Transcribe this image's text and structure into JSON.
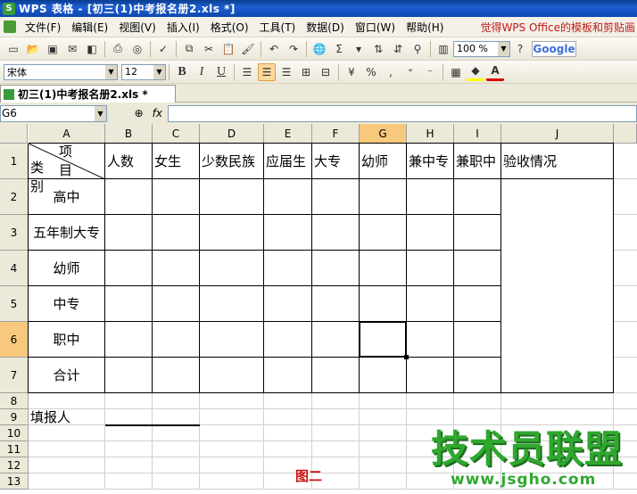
{
  "window": {
    "title": "WPS 表格 - [初三(1)中考报名册2.xls *]"
  },
  "menu": {
    "items": [
      "文件(F)",
      "编辑(E)",
      "视图(V)",
      "插入(I)",
      "格式(O)",
      "工具(T)",
      "数据(D)",
      "窗口(W)",
      "帮助(H)"
    ],
    "promo": "觉得WPS Office的模板和剪贴画"
  },
  "toolbar": {
    "zoom": "100 %",
    "search_brand": "Google"
  },
  "format_toolbar": {
    "font_name": "宋体",
    "font_size": "12",
    "bold": "B",
    "italic": "I",
    "underline": "U",
    "percent": "%"
  },
  "tabs": [
    {
      "label": "初三(1)中考报名册2.xls *"
    }
  ],
  "formula_bar": {
    "cell_ref": "G6",
    "fx": "fx",
    "value": ""
  },
  "sheet": {
    "columns": [
      "A",
      "B",
      "C",
      "D",
      "E",
      "F",
      "G",
      "H",
      "I",
      "J"
    ],
    "rows": [
      "1",
      "2",
      "3",
      "4",
      "5",
      "6",
      "7",
      "8",
      "9",
      "10",
      "11",
      "12",
      "13"
    ],
    "selected_col": "G",
    "selected_row": "6",
    "diag_top": "项目",
    "diag_bottom": "类别",
    "headers": [
      "人数",
      "女生",
      "少数民族",
      "应届生",
      "大专",
      "幼师",
      "兼中专",
      "兼职中",
      "验收情况"
    ],
    "row_labels": [
      "高中",
      "五年制大专",
      "幼师",
      "中专",
      "职中",
      "合计"
    ],
    "filler_label": "填报人"
  },
  "caption": "图二",
  "watermark": {
    "main": "技术员联盟",
    "sub": "www.jsgho.com"
  },
  "colors": {
    "selected_header": "#f8c97c",
    "caption": "#d01010",
    "watermark": "#2fa82f"
  }
}
